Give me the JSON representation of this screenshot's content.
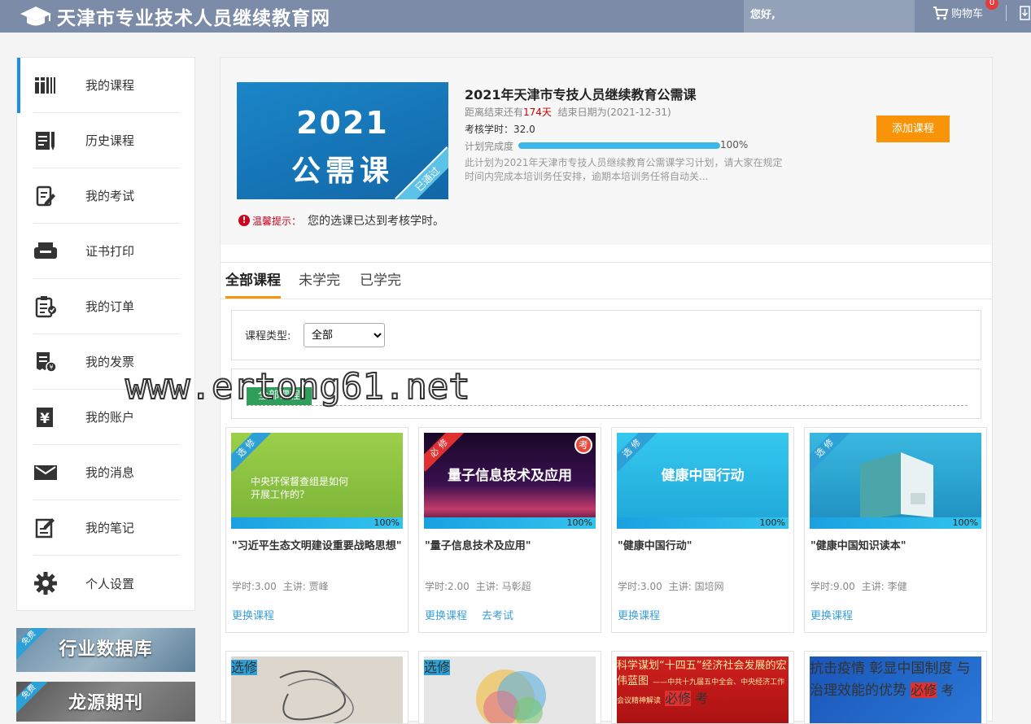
{
  "header": {
    "site_title": "天津市专业技术人员继续教育网",
    "greeting": "您好,",
    "cart_label": "购物车",
    "cart_count": "0"
  },
  "sidebar": {
    "items": [
      {
        "label": "我的课程",
        "icon": "books-icon"
      },
      {
        "label": "历史课程",
        "icon": "notebook-pen-icon"
      },
      {
        "label": "我的考试",
        "icon": "exam-edit-icon"
      },
      {
        "label": "证书打印",
        "icon": "printer-icon"
      },
      {
        "label": "我的订单",
        "icon": "clipboard-check-icon"
      },
      {
        "label": "我的发票",
        "icon": "invoice-icon"
      },
      {
        "label": "我的账户",
        "icon": "yen-wallet-icon"
      },
      {
        "label": "我的消息",
        "icon": "envelope-icon"
      },
      {
        "label": "我的笔记",
        "icon": "note-edit-icon"
      },
      {
        "label": "个人设置",
        "icon": "gear-icon"
      }
    ],
    "banners": [
      {
        "tag": "免费",
        "label": "行业数据库"
      },
      {
        "tag": "免费",
        "label": "龙源期刊"
      }
    ]
  },
  "plan": {
    "image_year": "2021",
    "image_kind": "公需课",
    "image_badge": "已通过",
    "title": "2021年天津市专技人员继续教育公需课",
    "remain_prefix": "距离结束还有",
    "remain_days": "174天",
    "end_date": "结束日期为(2021-12-31)",
    "hours": "考核学时：32.0",
    "progress_label": "计划完成度",
    "progress_value": "100%",
    "progress_fraction": 1.0,
    "description": "此计划为2021年天津市专技人员继续教育公需课学习计划，请大家在规定时间内完成本培训务任安排，逾期本培训务任将自动关...",
    "add_button": "添加课程",
    "warning_label": "温馨提示：",
    "warning_text": "您的选课已达到考核学时。"
  },
  "tabs": [
    "全部课程",
    "未学完",
    "已学完"
  ],
  "filter": {
    "label": "课程类型:",
    "selected": "全部"
  },
  "section": {
    "tag": "全部课程"
  },
  "watermark": "www.ertong61.net",
  "courses": [
    {
      "ribbon": "选修",
      "ribbon_color": "#2ea0d8",
      "thumb_color": "#8cc540",
      "thumb_text": "中央环保督查组是如何开展工作的？",
      "exam": "",
      "progress": "100%",
      "title": "\"习近平生态文明建设重要战略思想\"",
      "hours": "学时:3.00",
      "speaker": "主讲: 贾峰",
      "actions": [
        "更换课程"
      ]
    },
    {
      "ribbon": "必修",
      "ribbon_color": "#e03030",
      "thumb_color": "#2a0d3a",
      "thumb_text": "量子信息技术及应用",
      "exam": "考",
      "progress": "100%",
      "title": "\"量子信息技术及应用\"",
      "hours": "学时:2.00",
      "speaker": "主讲: 马彰超",
      "actions": [
        "更换课程",
        "去考试"
      ]
    },
    {
      "ribbon": "选修",
      "ribbon_color": "#2ea0d8",
      "thumb_color": "#2bbfe6",
      "thumb_text": "健康中国行动",
      "exam": "",
      "progress": "100%",
      "title": "\"健康中国行动\"",
      "hours": "学时:3.00",
      "speaker": "主讲: 国培网",
      "actions": [
        "更换课程"
      ]
    },
    {
      "ribbon": "选修",
      "ribbon_color": "#2ea0d8",
      "thumb_color": "#2fb0d8",
      "thumb_text": "",
      "exam": "",
      "progress": "100%",
      "title": "\"健康中国知识读本\"",
      "hours": "学时:9.00",
      "speaker": "主讲: 李健",
      "actions": [
        "更换课程"
      ]
    }
  ],
  "courses_row2": [
    {
      "ribbon": "选修",
      "ribbon_color": "#2ea0d8",
      "thumb_color": "#ddd6cc",
      "thumb_text": "",
      "exam": ""
    },
    {
      "ribbon": "选修",
      "ribbon_color": "#2ea0d8",
      "thumb_color": "#e4e4e4",
      "thumb_text": "",
      "exam": ""
    },
    {
      "ribbon": "必修",
      "ribbon_color": "#e03030",
      "thumb_color": "#c41a1a",
      "thumb_text": "科学谋划“十四五”经济社会发展的宏伟蓝图",
      "thumb_sub": "——中共十九届五中全会、中央经济工作会议精神解读",
      "exam": "考"
    },
    {
      "ribbon": "必修",
      "ribbon_color": "#e03030",
      "thumb_color": "#1c5fc0",
      "thumb_text": "抗击疫情 彰显中国制度",
      "thumb_sub": "与治理效能的优势",
      "exam": "考"
    }
  ]
}
